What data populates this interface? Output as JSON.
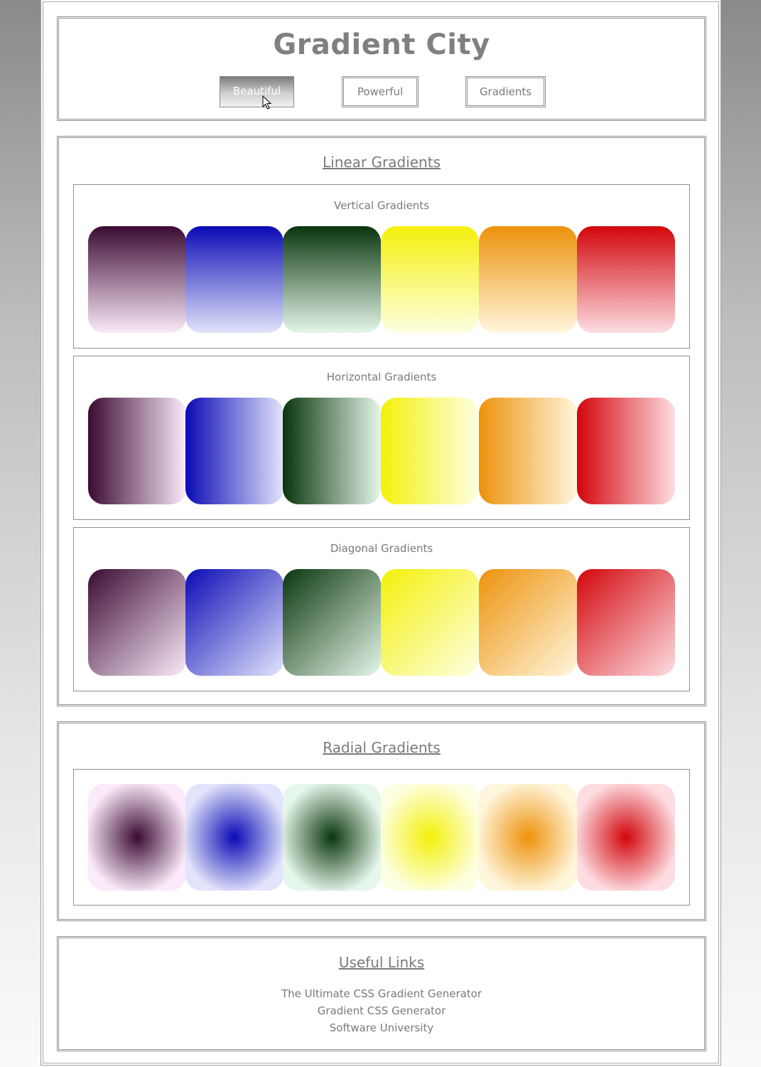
{
  "header": {
    "title": "Gradient City",
    "nav": [
      "Beautiful",
      "Powerful",
      "Gradients"
    ],
    "active": "Beautiful"
  },
  "linear": {
    "title": "Linear Gradients",
    "vertical_title": "Vertical Gradients",
    "horizontal_title": "Horizontal Gradients",
    "diagonal_title": "Diagonal Gradients"
  },
  "radial": {
    "title": "Radial Gradients"
  },
  "links": {
    "title": "Useful Links",
    "items": [
      "The Ultimate CSS Gradient Generator",
      "Gradient CSS Generator",
      "Software University"
    ]
  },
  "colors": {
    "purple": [
      "#3b0a33",
      "#fbeaf9"
    ],
    "blue": [
      "#0a0ab5",
      "#e2e4fb"
    ],
    "green": [
      "#0a350c",
      "#e4f7ea"
    ],
    "yellow": [
      "#f4f00a",
      "#fdffe2"
    ],
    "orange": [
      "#ed920c",
      "#fff6dc"
    ],
    "red": [
      "#d2060b",
      "#fddde2"
    ]
  }
}
